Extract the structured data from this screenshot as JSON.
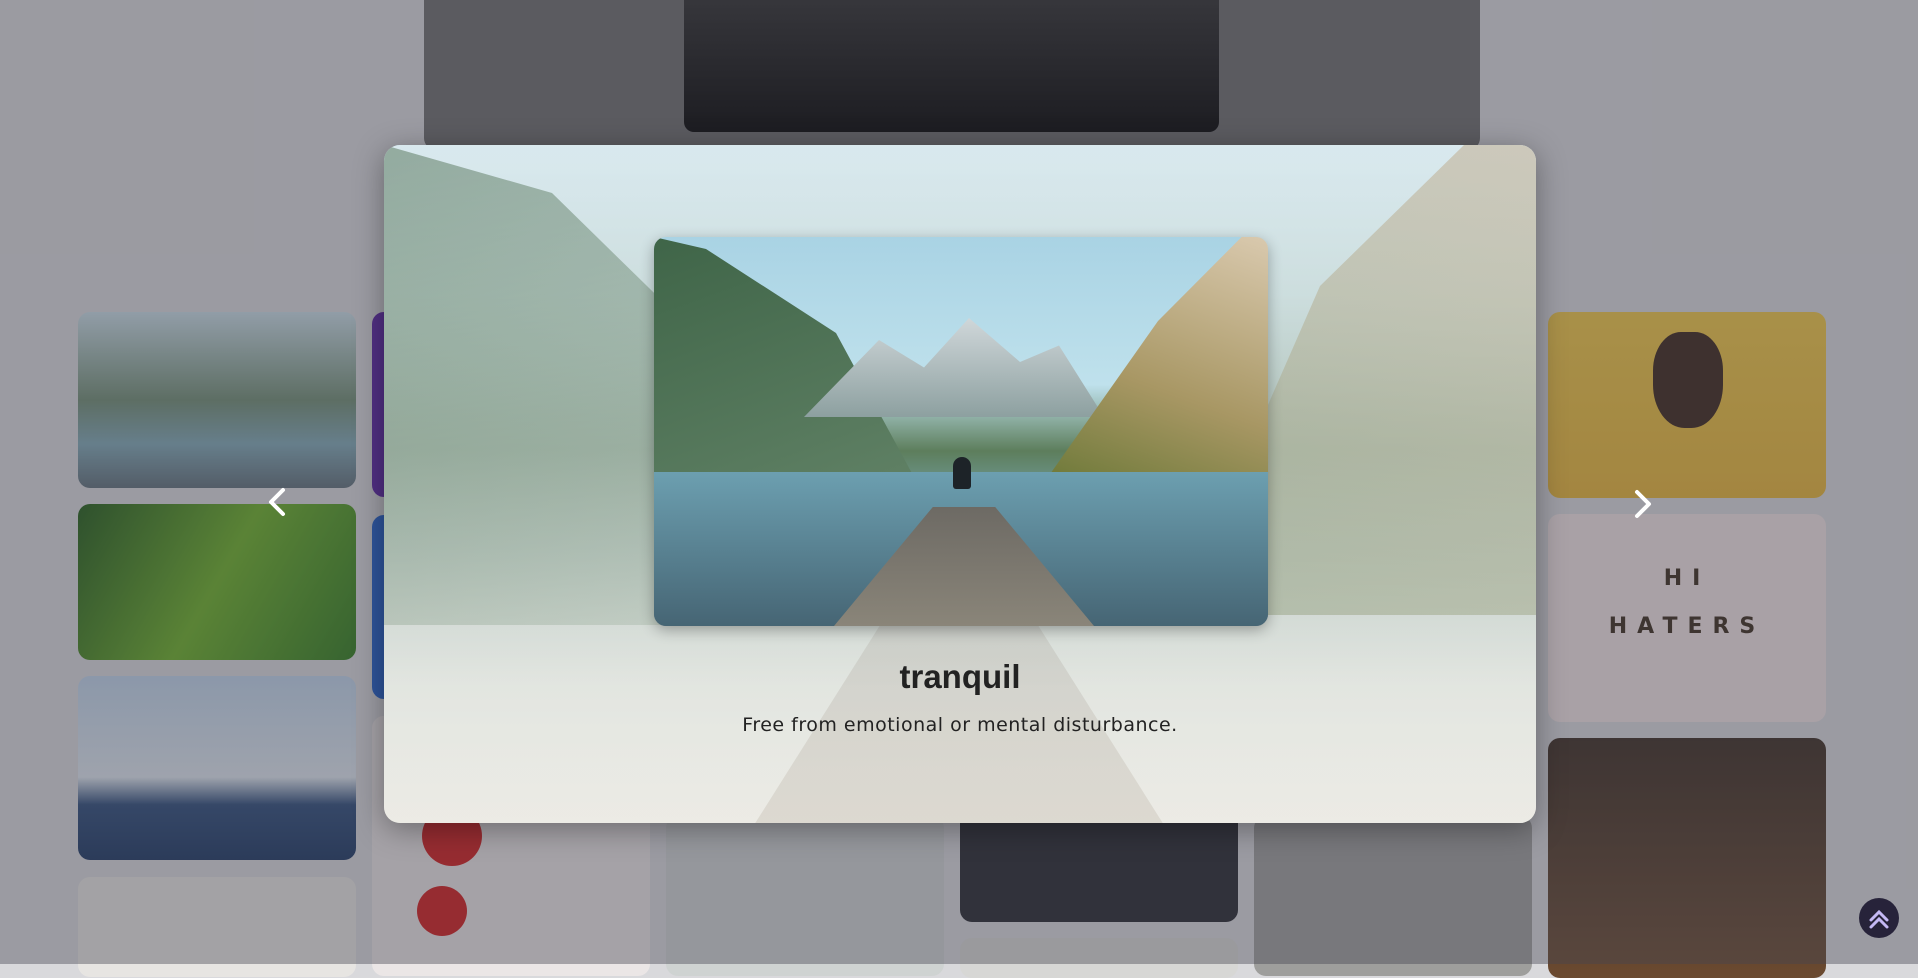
{
  "modal": {
    "title": "tranquil",
    "description": "Free from emotional or mental disturbance."
  },
  "nav": {
    "prev_symbol": "‹",
    "next_symbol": "›"
  },
  "scroll_top_symbol": "⌃",
  "background_tiles": {
    "tile_2_text_line1": "HI",
    "tile_2_text_line2": "HATERS"
  },
  "colors": {
    "overlay": "#46465080",
    "scroll_top_bg": "#27233a",
    "scroll_top_icon": "#c4b8f4"
  }
}
